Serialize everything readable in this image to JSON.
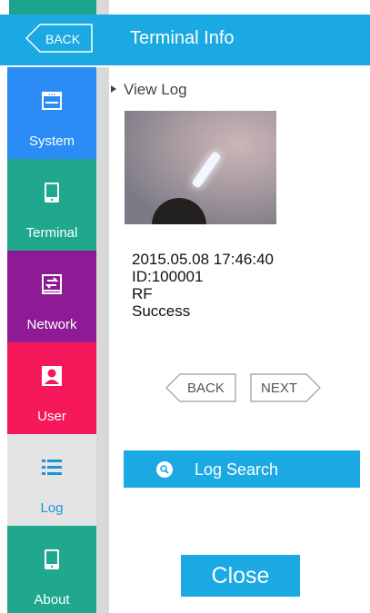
{
  "header": {
    "back_label": "BACK",
    "title": "Terminal Info"
  },
  "sidebar": {
    "items": [
      {
        "label": "System"
      },
      {
        "label": "Terminal"
      },
      {
        "label": "Network"
      },
      {
        "label": "User"
      },
      {
        "label": "Log"
      },
      {
        "label": "About"
      }
    ]
  },
  "main": {
    "breadcrumb": "View Log",
    "log": {
      "datetime": "2015.05.08  17:46:40",
      "id": "ID:100001",
      "method": "RF",
      "result": "Success"
    },
    "back_label": "BACK",
    "next_label": "NEXT",
    "search_label": "Log Search",
    "close_label": "Close"
  },
  "colors": {
    "header": "#1aa9e3",
    "system": "#2b8cf5",
    "terminal": "#1fa88e",
    "network": "#8e1a95",
    "user": "#f5185a",
    "log": "#e4e4e4",
    "about": "#1fa88e"
  },
  "icons": {
    "back": "chevron-left-icon",
    "system": "monitor-icon",
    "terminal": "tablet-icon",
    "network": "network-icon",
    "user": "user-icon",
    "log": "list-icon",
    "about": "tablet-icon",
    "search": "search-icon"
  }
}
